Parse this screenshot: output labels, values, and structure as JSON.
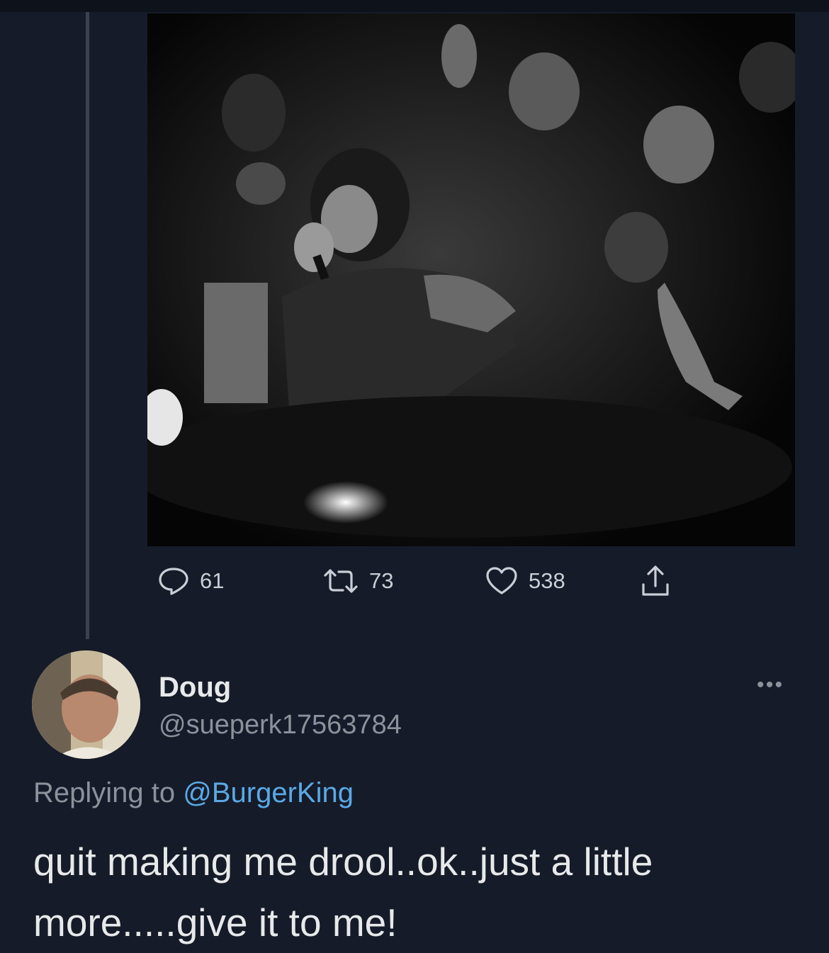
{
  "media": {
    "icon": "photo-concert-singer"
  },
  "actions": {
    "reply_count": "61",
    "retweet_count": "73",
    "like_count": "538"
  },
  "reply": {
    "name": "Doug",
    "handle": "@sueperk17563784",
    "replying_prefix": "Replying to",
    "replying_to": "@BurgerKing",
    "text": "quit making me drool..ok..just a little more.....give it to me!",
    "more_icon": "more-dots-icon"
  },
  "colors": {
    "background": "#161b29",
    "text": "#e7e9ea",
    "secondary": "#8b929c",
    "link": "#5aa9e6"
  }
}
